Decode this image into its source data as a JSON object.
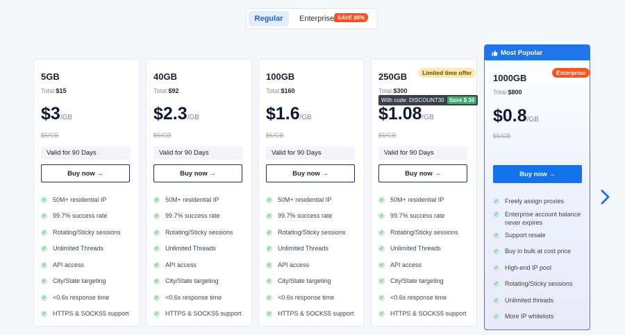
{
  "toggle": {
    "regular": "Regular",
    "enterprise": "Enterprise",
    "save_badge": "SAVE 86%"
  },
  "plans": [
    {
      "size": "5GB",
      "total_label": "Total:",
      "total": "$15",
      "price": "$3",
      "unit": "/GB",
      "old_price": "$5/GB",
      "valid": "Valid for 90 Days",
      "buy": "Buy now →"
    },
    {
      "size": "40GB",
      "total_label": "Total:",
      "total": "$92",
      "price": "$2.3",
      "unit": "/GB",
      "old_price": "$5/GB",
      "valid": "Valid for 90 Days",
      "buy": "Buy now →"
    },
    {
      "size": "100GB",
      "total_label": "Total:",
      "total": "$160",
      "price": "$1.6",
      "unit": "/GB",
      "old_price": "$5/GB",
      "valid": "Valid for 90 Days",
      "buy": "Buy now →"
    },
    {
      "size": "250GB",
      "total_label": "Total:",
      "total": "$300",
      "price": "$1.08",
      "unit": "/GB",
      "old_price": "$5/GB",
      "valid": "Valid for 90 Days",
      "buy": "Buy now →",
      "badge": "Limited time offer",
      "code": "With code: DISCOUNT30",
      "code_save": "Save $ 30"
    }
  ],
  "features": [
    "50M+ residential IP",
    "99.7% success rate",
    "Rotating/Sticky sessions",
    "Unlimited Threads",
    "API access",
    "City/State targeting",
    "<0.6s response time",
    "HTTPS & SOCKS5 support"
  ],
  "popular": {
    "header": "Most Popular",
    "size": "1000GB",
    "badge": "Enterprise",
    "total_label": "Total:",
    "total": "$800",
    "price": "$0.8",
    "unit": "/GB",
    "old_price": "$5/GB",
    "buy": "Buy now →",
    "features": [
      "Freely assign proxies",
      "Enterprise account balance never expires",
      "Support resale",
      "Buy in bulk at cost price",
      "High-end IP pool",
      "Rotating/Sticky sessions",
      "Unlimited threads",
      "More IP whitelists"
    ]
  },
  "colors": {
    "accent": "#1f75ec",
    "save": "#ff4f1f",
    "check": "#27a05a"
  },
  "icons": {
    "check": "check-icon",
    "thumb": "thumbs-up-icon",
    "next": "chevron-right-icon"
  }
}
